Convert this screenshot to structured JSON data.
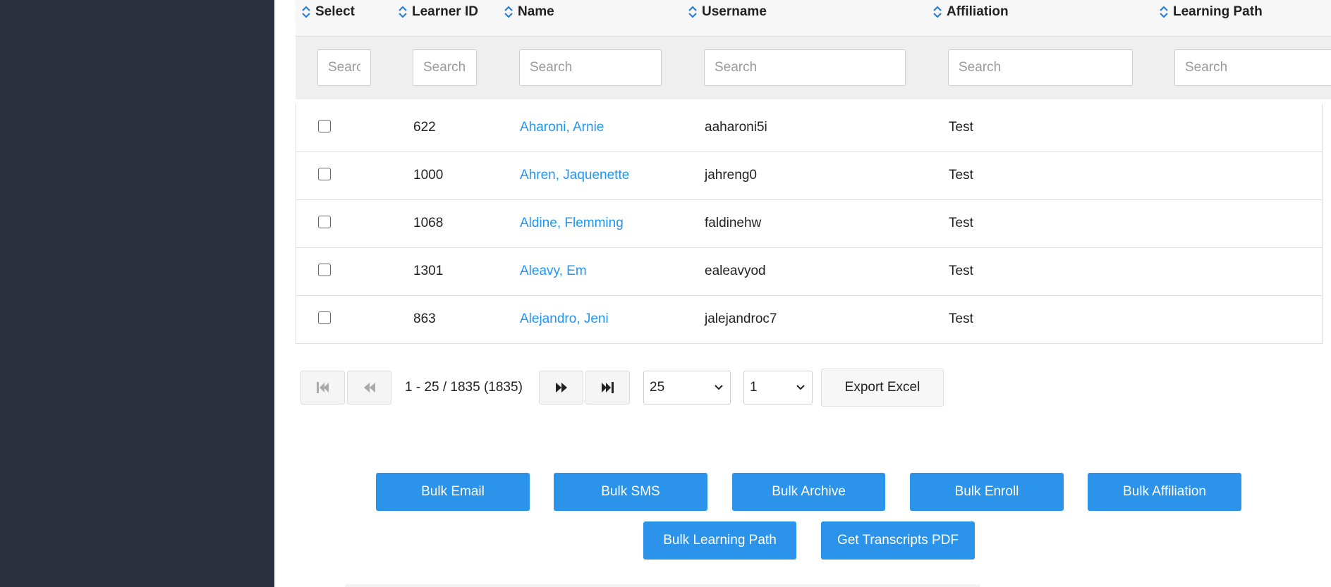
{
  "table": {
    "columns": [
      {
        "key": "select",
        "label": "Select"
      },
      {
        "key": "learner_id",
        "label": "Learner ID"
      },
      {
        "key": "name",
        "label": "Name"
      },
      {
        "key": "username",
        "label": "Username"
      },
      {
        "key": "affiliation",
        "label": "Affiliation"
      },
      {
        "key": "learning_path",
        "label": "Learning Path"
      }
    ],
    "filters": {
      "select_placeholder": "Search",
      "learner_id_placeholder": "Search",
      "name_placeholder": "Search",
      "username_placeholder": "Search",
      "affiliation_placeholder": "Search",
      "learning_path_placeholder": "Search"
    },
    "rows": [
      {
        "learner_id": "622",
        "name": "Aharoni, Arnie",
        "username": "aaharoni5i",
        "affiliation": "Test",
        "learning_path": ""
      },
      {
        "learner_id": "1000",
        "name": "Ahren, Jaquenette",
        "username": "jahreng0",
        "affiliation": "Test",
        "learning_path": ""
      },
      {
        "learner_id": "1068",
        "name": "Aldine, Flemming",
        "username": "faldinehw",
        "affiliation": "Test",
        "learning_path": ""
      },
      {
        "learner_id": "1301",
        "name": "Aleavy, Em",
        "username": "ealeavyod",
        "affiliation": "Test",
        "learning_path": ""
      },
      {
        "learner_id": "863",
        "name": "Alejandro, Jeni",
        "username": "jalejandroc7",
        "affiliation": "Test",
        "learning_path": ""
      }
    ]
  },
  "pager": {
    "info": "1 - 25 / 1835 (1835)",
    "page_size": "25",
    "page": "1",
    "export_label": "Export Excel"
  },
  "bulk_actions": {
    "email": "Bulk Email",
    "sms": "Bulk SMS",
    "archive": "Bulk Archive",
    "enroll": "Bulk Enroll",
    "affiliation": "Bulk Affiliation",
    "learning_path": "Bulk Learning Path",
    "transcripts": "Get Transcripts PDF"
  },
  "colors": {
    "sidebar": "#2a2f3e",
    "link": "#2196f3",
    "primary_button": "#2b93ea"
  },
  "icons": [
    "sort-icon",
    "first-page-icon",
    "prev-page-icon",
    "next-page-icon",
    "last-page-icon",
    "chevron-down-icon"
  ]
}
